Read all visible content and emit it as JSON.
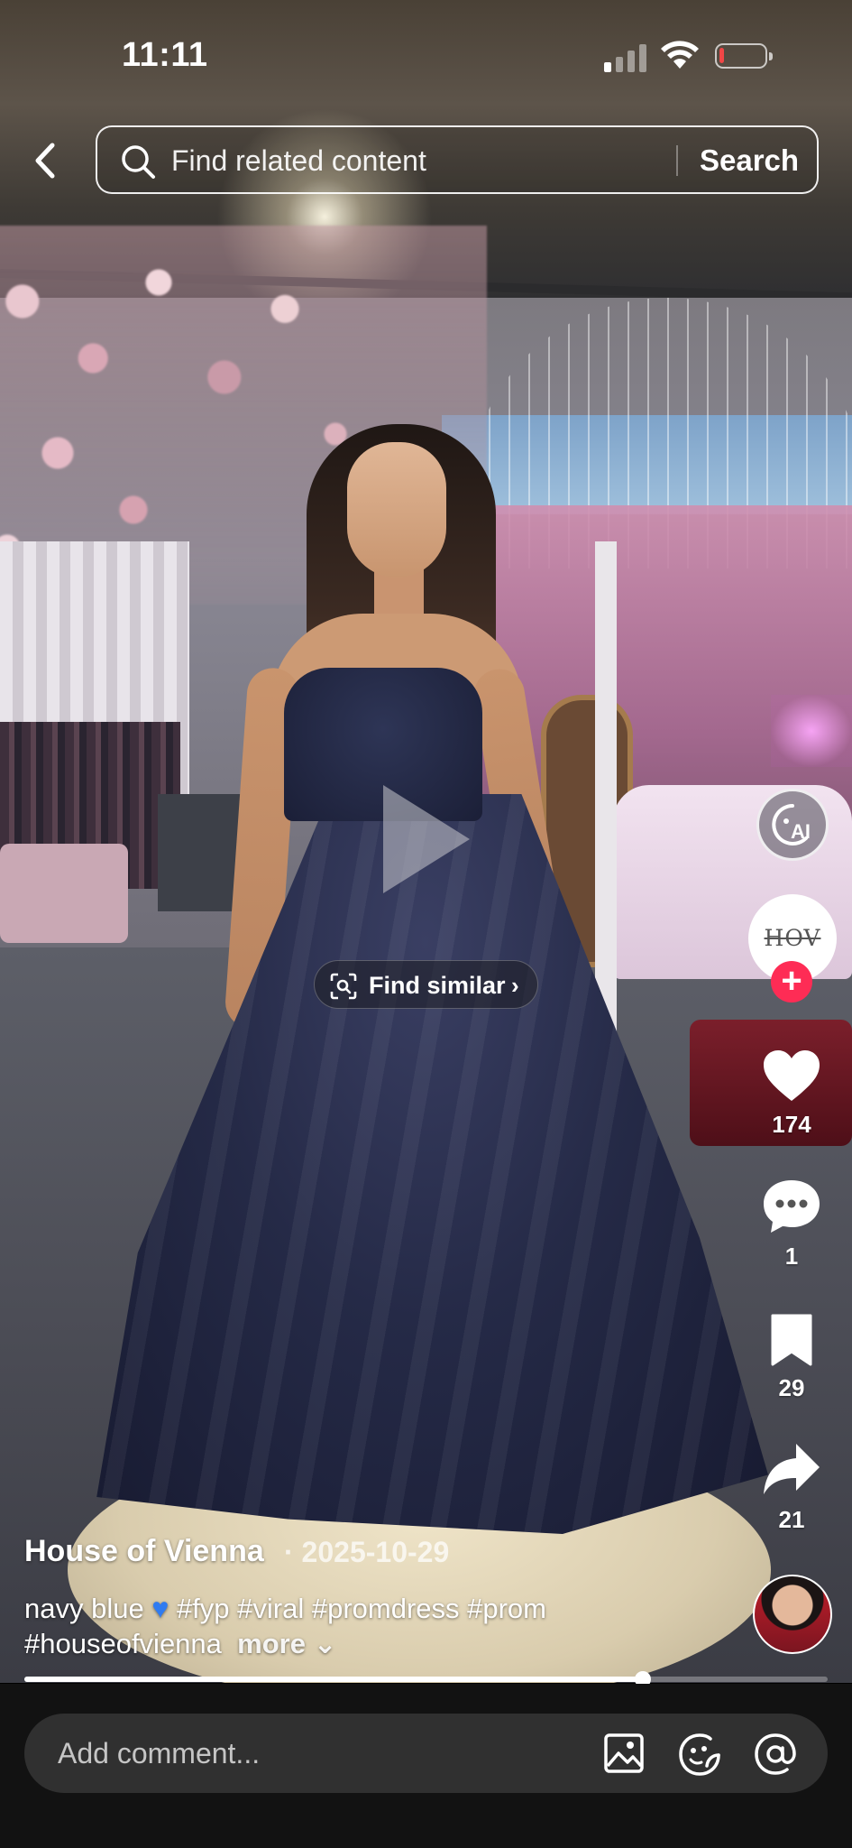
{
  "status_bar": {
    "time": "11:11",
    "battery_level": 0.1,
    "signal_bars_active": 1
  },
  "search": {
    "placeholder": "Find related content",
    "button_label": "Search"
  },
  "video": {
    "find_similar_label": "Find similar",
    "progress": 0.77
  },
  "actions": {
    "likes": "174",
    "comments": "1",
    "favorites": "29",
    "shares": "21",
    "ai_label": "AI",
    "avatar_logo": "HOV"
  },
  "post": {
    "author": "House of Vienna",
    "date": "· 2025-10-29",
    "caption_start": "navy blue ",
    "caption_tags": " #fyp #viral #promdress #prom #houseofvienna",
    "more_label": "more"
  },
  "comment_bar": {
    "placeholder": "Add comment..."
  },
  "colors": {
    "follow_plus": "#fe2c55",
    "battery_low": "#f04646",
    "bottom_bar": "#121212",
    "comment_field": "#303030"
  }
}
